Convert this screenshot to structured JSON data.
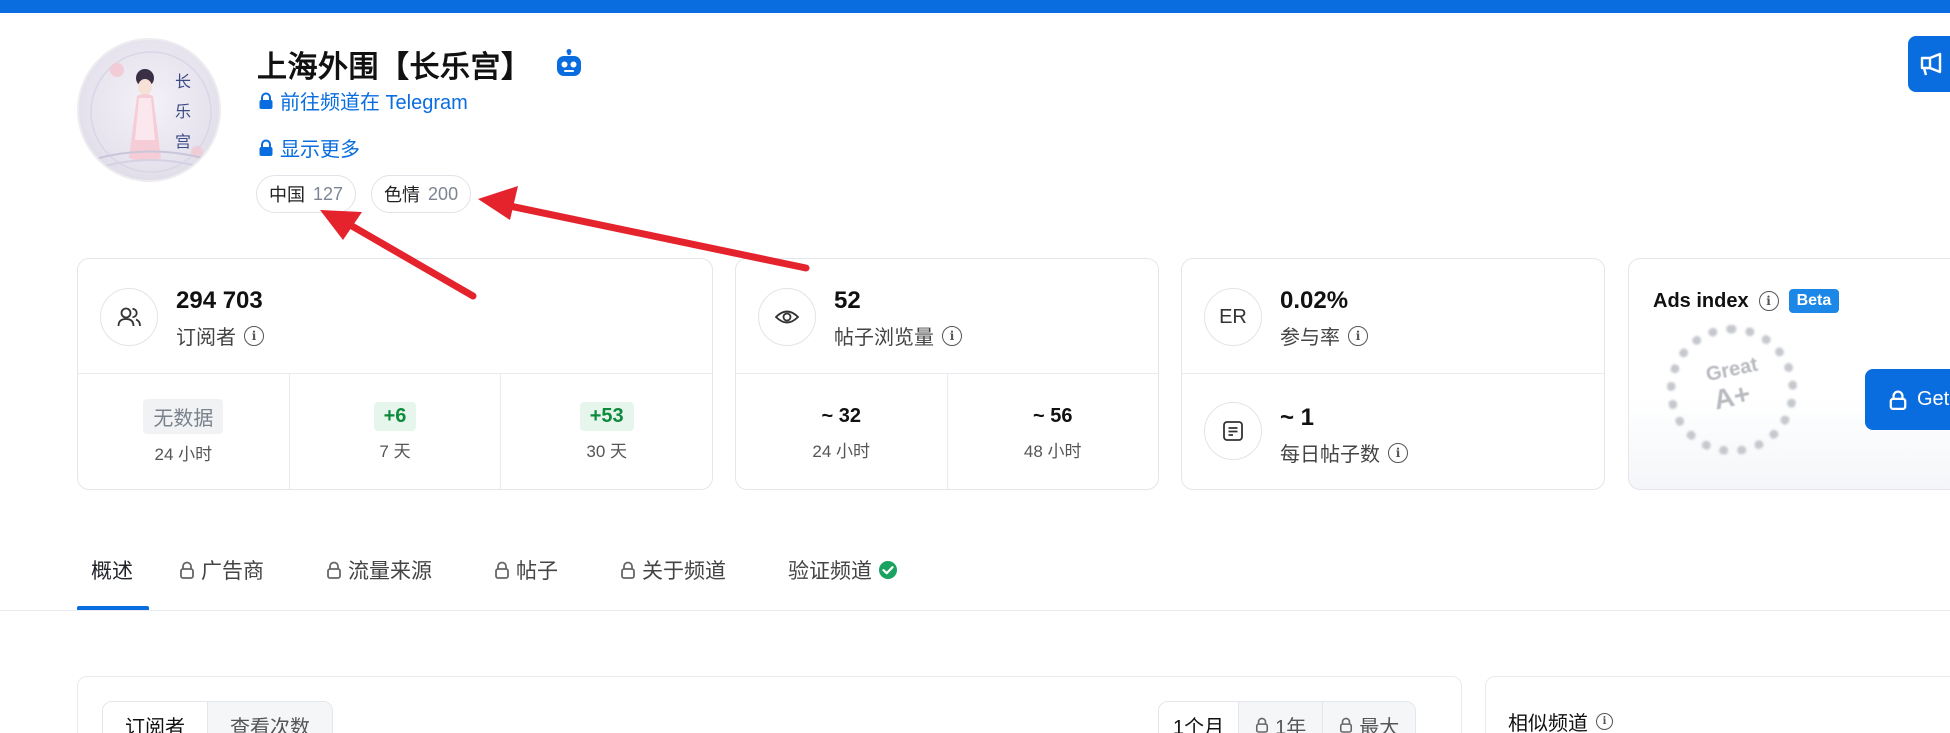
{
  "channel": {
    "title": "上海外围【长乐宫】",
    "avatar_text": [
      "长",
      "乐",
      "宫"
    ],
    "telegram_link": "前往频道在 Telegram",
    "show_more": "显示更多",
    "tags": [
      {
        "label": "中国",
        "count": "127"
      },
      {
        "label": "色情",
        "count": "200"
      }
    ]
  },
  "subscribers": {
    "value": "294 703",
    "label": "订阅者",
    "cells": [
      {
        "value": "无数据",
        "label": "24 小时"
      },
      {
        "value": "+6",
        "label": "7 天"
      },
      {
        "value": "+53",
        "label": "30 天"
      }
    ]
  },
  "views": {
    "value": "52",
    "label": "帖子浏览量",
    "cells": [
      {
        "value": "~ 32",
        "label": "24 小时"
      },
      {
        "value": "~ 56",
        "label": "48 小时"
      }
    ]
  },
  "engagement": {
    "icon_text": "ER",
    "value": "0.02%",
    "label": "参与率",
    "daily_value": "~ 1",
    "daily_label": "每日帖子数"
  },
  "ads": {
    "title": "Ads index",
    "badge": "Beta",
    "rating_word": "Great",
    "rating_grade": "A+",
    "button": "Get"
  },
  "tabs": [
    {
      "label": "概述",
      "locked": false,
      "active": true
    },
    {
      "label": "广告商",
      "locked": true
    },
    {
      "label": "流量来源",
      "locked": true
    },
    {
      "label": "帖子",
      "locked": true
    },
    {
      "label": "关于频道",
      "locked": true
    },
    {
      "label": "验证频道",
      "locked": false,
      "verified": true
    }
  ],
  "chart_toggle": [
    "订阅者",
    "查看次数"
  ],
  "period_toggle": [
    {
      "label": "1个月",
      "locked": false
    },
    {
      "label": "1年",
      "locked": true
    },
    {
      "label": "最大",
      "locked": true
    }
  ],
  "similar": {
    "title": "相似频道"
  },
  "colors": {
    "accent": "#0a6ddf",
    "annotation": "#e5232d",
    "green": "#0e8a3c"
  }
}
